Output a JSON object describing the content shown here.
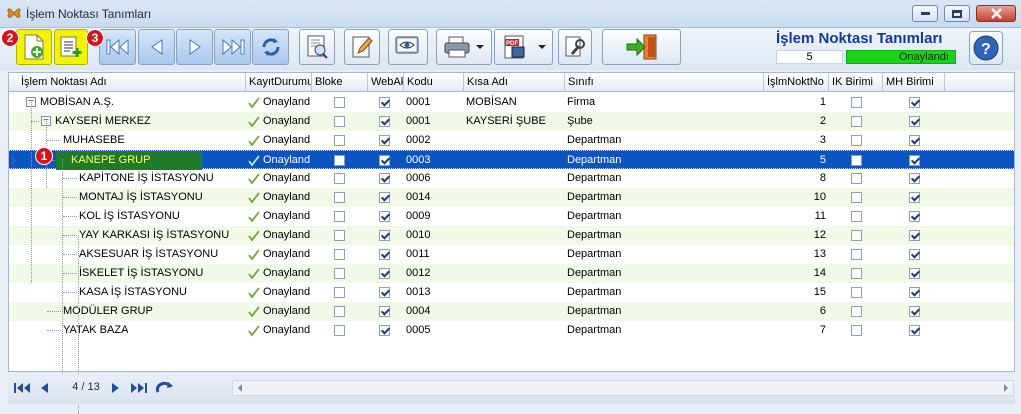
{
  "window": {
    "title": "İşlem Noktası Tanımları"
  },
  "header": {
    "title": "İşlem Noktası Tanımları",
    "count": "5",
    "status": "Onaylandı",
    "status_color": "#1bd21b"
  },
  "badges": [
    "1",
    "2",
    "3"
  ],
  "toolbar": {
    "buttons": [
      "add-new-icon",
      "add-child-icon",
      "first-record-icon",
      "prev-record-icon",
      "next-record-icon",
      "last-record-icon",
      "refresh-icon",
      "preview-icon",
      "edit-icon",
      "view-icon",
      "print-icon",
      "pdf-export-icon",
      "tools-icon",
      "exit-icon",
      "help-icon"
    ]
  },
  "columns": [
    "İşlem Noktası Adı",
    "KayıtDurumu",
    "Bloke",
    "WebAk",
    "Kodu",
    "Kısa Adı",
    "Sınıfı",
    "İşlmNoktNo",
    "IK Birimi",
    "MH Birimi"
  ],
  "rows": [
    {
      "name": "MOBİSAN A.Ş.",
      "status": "Onaylandı",
      "bloke": false,
      "web": true,
      "code": "0001",
      "short": "MOBİSAN",
      "class": "Firma",
      "no": "1",
      "ik": false,
      "mh": true,
      "level": 0,
      "exp": "−"
    },
    {
      "name": "KAYSERİ MERKEZ",
      "status": "Onaylandı",
      "bloke": false,
      "web": true,
      "code": "0001",
      "short": "KAYSERİ ŞUBE",
      "class": "Şube",
      "no": "2",
      "ik": false,
      "mh": true,
      "level": 1,
      "exp": "−"
    },
    {
      "name": "MUHASEBE",
      "status": "Onaylandı",
      "bloke": false,
      "web": true,
      "code": "0002",
      "short": "",
      "class": "Departman",
      "no": "3",
      "ik": false,
      "mh": true,
      "level": 2,
      "exp": ""
    },
    {
      "name": "KANEPE GRUP",
      "status": "Onaylandı",
      "bloke": false,
      "web": true,
      "code": "0003",
      "short": "",
      "class": "Departman",
      "no": "5",
      "ik": false,
      "mh": true,
      "level": 2,
      "exp": "−",
      "selected": true
    },
    {
      "name": "KAPİTONE İŞ İSTASYONU",
      "status": "Onaylandı",
      "bloke": false,
      "web": true,
      "code": "0006",
      "short": "",
      "class": "Departman",
      "no": "8",
      "ik": false,
      "mh": true,
      "level": 3,
      "exp": ""
    },
    {
      "name": "MONTAJ İŞ İSTASYONU",
      "status": "Onaylandı",
      "bloke": false,
      "web": true,
      "code": "0014",
      "short": "",
      "class": "Departman",
      "no": "10",
      "ik": false,
      "mh": true,
      "level": 3,
      "exp": ""
    },
    {
      "name": "KOL İŞ İSTASYONU",
      "status": "Onaylandı",
      "bloke": false,
      "web": true,
      "code": "0009",
      "short": "",
      "class": "Departman",
      "no": "11",
      "ik": false,
      "mh": true,
      "level": 3,
      "exp": ""
    },
    {
      "name": "YAY KARKASI İŞ İSTASYONU",
      "status": "Onaylandı",
      "bloke": false,
      "web": true,
      "code": "0010",
      "short": "",
      "class": "Departman",
      "no": "12",
      "ik": false,
      "mh": true,
      "level": 3,
      "exp": ""
    },
    {
      "name": "AKSESUAR İŞ İSTASYONU",
      "status": "Onaylandı",
      "bloke": false,
      "web": true,
      "code": "0011",
      "short": "",
      "class": "Departman",
      "no": "13",
      "ik": false,
      "mh": true,
      "level": 3,
      "exp": ""
    },
    {
      "name": "İSKELET İŞ İSTASYONU",
      "status": "Onaylandı",
      "bloke": false,
      "web": true,
      "code": "0012",
      "short": "",
      "class": "Departman",
      "no": "14",
      "ik": false,
      "mh": true,
      "level": 3,
      "exp": ""
    },
    {
      "name": "KASA İŞ İSTASYONU",
      "status": "Onaylandı",
      "bloke": false,
      "web": true,
      "code": "0013",
      "short": "",
      "class": "Departman",
      "no": "15",
      "ik": false,
      "mh": true,
      "level": 3,
      "exp": ""
    },
    {
      "name": "MODÜLER GRUP",
      "status": "Onaylandı",
      "bloke": false,
      "web": true,
      "code": "0004",
      "short": "",
      "class": "Departman",
      "no": "6",
      "ik": false,
      "mh": true,
      "level": 2,
      "exp": ""
    },
    {
      "name": "YATAK BAZA",
      "status": "Onaylandı",
      "bloke": false,
      "web": true,
      "code": "0005",
      "short": "",
      "class": "Departman",
      "no": "7",
      "ik": false,
      "mh": true,
      "level": 2,
      "exp": ""
    }
  ],
  "navigator": {
    "page": "4 / 13"
  }
}
